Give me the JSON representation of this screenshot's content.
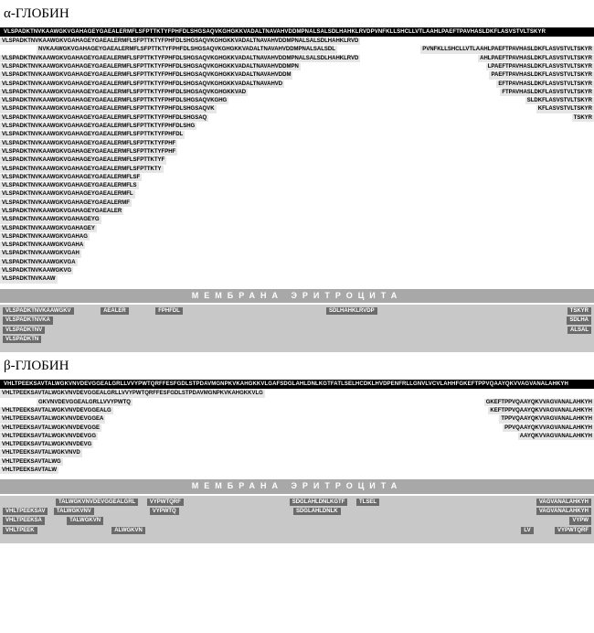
{
  "alpha": {
    "title": "α-ГЛОБИН",
    "full": "VLSPADKTNVKAAWGKVGAHAGEYGAEALERMFLSFPTTKTYFPHFDLSHGSAQVKGHGKKVADALTNAVAHVDDMPNALSALSDLHAHKLRVDPVNFKLLSHCLLVTLAAHLPAEFTPAVHASLDKFLASVSTVLTSKYR",
    "rows": [
      {
        "left": "VLSPADKTNVKAAWGKVGAHAGEYGAEALERMFLSFPTTKTYFPHFDLSHGSAQVKGHGKKVADALTNAVAHVDDMPNALSALSDLHAHKLRVD",
        "right": ""
      },
      {
        "left": "NVKAAWGKVGAHAGEYGAEALERMFLSFPTTKTYFPHFDLSHGSAQVKGHGKKVADALTNAVAHVDDMPNALSALSDL",
        "indent": true,
        "right": "PVNFKLLSHCLLVTLAAHLPAEFTPAVHASLDKFLASVSTVLTSKYR"
      },
      {
        "left": "VLSPADKTNVKAAWGKVGAHAGEYGAEALERMFLSFPTTKTYFPHFDLSHGSAQVKGHGKKVADALTNAVAHVDDMPNALSALSDLHAHKLRVD",
        "right": "AHLPAEFTPAVHASLDKFLASVSTVLTSKYR"
      },
      {
        "left": "VLSPADKTNVKAAWGKVGAHAGEYGAEALERMFLSFPTTKTYFPHFDLSHGSAQVKGHGKKVADALTNAVAHVDDMPN",
        "right": "LPAEFTPAVHASLDKFLASVSTVLTSKYR"
      },
      {
        "left": "VLSPADKTNVKAAWGKVGAHAGEYGAEALERMFLSFPTTKTYFPHFDLSHGSAQVKGHGKKVADALTNAVAHVDDM",
        "right": "PAEFTPAVHASLDKFLASVSTVLTSKYR"
      },
      {
        "left": "VLSPADKTNVKAAWGKVGAHAGEYGAEALERMFLSFPTTKTYFPHFDLSHGSAQVKGHGKKVADALTNAVAHVD",
        "right": "EFTPAVHASLDKFLASVSTVLTSKYR"
      },
      {
        "left": "VLSPADKTNVKAAWGKVGAHAGEYGAEALERMFLSFPTTKTYFPHFDLSHGSAQVKGHGKKVAD",
        "right": "FTPAVHASLDKFLASVSTVLTSKYR"
      },
      {
        "left": "VLSPADKTNVKAAWGKVGAHAGEYGAEALERMFLSFPTTKTYFPHFDLSHGSAQVKGHG",
        "right": "SLDKFLASVSTVLTSKYR"
      },
      {
        "left": "VLSPADKTNVKAAWGKVGAHAGEYGAEALERMFLSFPTTKTYFPHFDLSHGSAQVK",
        "right": "KFLASVSTVLTSKYR"
      },
      {
        "left": "VLSPADKTNVKAAWGKVGAHAGEYGAEALERMFLSFPTTKTYFPHFDLSHGSAQ",
        "right": "TSKYR"
      },
      {
        "left": "VLSPADKTNVKAAWGKVGAHAGEYGAEALERMFLSFPTTKTYFPHFDLSHG",
        "right": ""
      },
      {
        "left": "VLSPADKTNVKAAWGKVGAHAGEYGAEALERMFLSFPTTKTYFPHFDL",
        "right": ""
      },
      {
        "left": "VLSPADKTNVKAAWGKVGAHAGEYGAEALERMFLSFPTTKTYFPHF",
        "right": ""
      },
      {
        "left": "VLSPADKTNVKAAWGKVGAHAGEYGAEALERMFLSFPTTKTYFPHF",
        "right": ""
      },
      {
        "left": "VLSPADKTNVKAAWGKVGAHAGEYGAEALERMFLSFPTTKTYF",
        "right": ""
      },
      {
        "left": "VLSPADKTNVKAAWGKVGAHAGEYGAEALERMFLSFPTTKTY",
        "right": ""
      },
      {
        "left": "VLSPADKTNVKAAWGKVGAHAGEYGAEALERMFLSF",
        "right": ""
      },
      {
        "left": "VLSPADKTNVKAAWGKVGAHAGEYGAEALERMFLS",
        "right": ""
      },
      {
        "left": "VLSPADKTNVKAAWGKVGAHAGEYGAEALERMFL",
        "right": ""
      },
      {
        "left": "VLSPADKTNVKAAWGKVGAHAGEYGAEALERMF",
        "right": ""
      },
      {
        "left": "VLSPADKTNVKAAWGKVGAHAGEYGAEALER",
        "right": ""
      },
      {
        "left": "VLSPADKTNVKAAWGKVGAHAGEYG",
        "right": ""
      },
      {
        "left": "VLSPADKTNVKAAWGKVGAHAGEY",
        "right": ""
      },
      {
        "left": "VLSPADKTNVKAAWGKVGAHAG",
        "right": ""
      },
      {
        "left": "VLSPADKTNVKAAWGKVGAHA",
        "right": ""
      },
      {
        "left": "VLSPADKTNVKAAWGKVGAH",
        "right": ""
      },
      {
        "left": "VLSPADKTNVKAAWGKVGA",
        "right": ""
      },
      {
        "left": "VLSPADKTNVKAAWGKVG",
        "right": ""
      },
      {
        "left": "VLSPADKTNVKAAW",
        "right": ""
      }
    ],
    "membrane_label": "МЕМБРАНА  ЭРИТРОЦИТА",
    "mem_rows": [
      [
        {
          "t": "VLSPADKTNVKAAWGKV"
        },
        {
          "sp": 1
        },
        {
          "t": "AEALER"
        },
        {
          "sp": 1
        },
        {
          "t": "FPHFDL"
        },
        {
          "sp": 6
        },
        {
          "t": "SDLHAHKLRVDP"
        },
        {
          "sp": 8
        },
        {
          "t": "TSKYR"
        }
      ],
      [
        {
          "t": "VLSPADKTNVKA"
        },
        {
          "sp": 18
        },
        {
          "t": "SDLHA"
        }
      ],
      [
        {
          "t": "VLSPADKTNV"
        },
        {
          "sp": 18
        },
        {
          "t": "ALSAL"
        }
      ],
      [
        {
          "t": "VLSPADKTN"
        }
      ]
    ]
  },
  "beta": {
    "title": "β-ГЛОБИН",
    "full": "VHLTPEEKSAVTALWGKVNVDEVGGEALGRLLVVYPWTQRFFESFGDLSTPDAVMGNPKVKAHGKKVLGAFSDGLAHLDNLKGTFATLSELHCDKLHVDPENFRLLGNVLVCVLAHHFGKEFTPPVQAAYQKVVAGVANALAHKYH",
    "rows": [
      {
        "left": "VHLTPEEKSAVTALWGKVNVDEVGGEALGRLLVVYPWTQRFFESFGDLSTPDAVMGNPKVKAHGKKVLG",
        "right": ""
      },
      {
        "left": "GKVNVDEVGGEALGRLLVVYPWTQ",
        "indent": true,
        "right": "GKEFTPPVQAAYQKVVAGVANALAHKYH"
      },
      {
        "left": "VHLTPEEKSAVTALWGKVNVDEVGGEALG",
        "right": "KEFTPPVQAAYQKVVAGVANALAHKYH"
      },
      {
        "left": "VHLTPEEKSAVTALWGKVNVDEVGGEA",
        "right": "TPPVQAAYQKVVAGVANALAHKYH"
      },
      {
        "left": "VHLTPEEKSAVTALWGKVNVDEVGGE",
        "right": "PPVQAAYQKVVAGVANALAHKYH"
      },
      {
        "left": "VHLTPEEKSAVTALWGKVNVDEVGG",
        "right": "AAYQKVVAGVANALAHKYH"
      },
      {
        "left": "VHLTPEEKSAVTALWGKVNVDEVG",
        "right": ""
      },
      {
        "left": "VHLTPEEKSAVTALWGKVNVD",
        "right": ""
      },
      {
        "left": "VHLTPEEKSAVTALWG",
        "right": ""
      },
      {
        "left": "VHLTPEEKSAVTALW",
        "right": ""
      }
    ],
    "membrane_label": "МЕМБРАНА  ЭРИТРОЦИТА",
    "mem_rows": [
      [
        {
          "sp": 2
        },
        {
          "t": "TALWGKVNVDEVGGEALGRL"
        },
        {
          "sp": 0.2
        },
        {
          "t": "VYPWTQRF"
        },
        {
          "sp": 4
        },
        {
          "t": "SDGLAHLDNLKGTF"
        },
        {
          "sp": 0.2
        },
        {
          "t": "TLSEL"
        },
        {
          "sp": 6
        },
        {
          "t": "VAGVANALAHKYH"
        }
      ],
      [
        {
          "t": "VHLTPEEKSAV"
        },
        {
          "sp": 0.1
        },
        {
          "t": "TALWGKVNV"
        },
        {
          "sp": 2.3
        },
        {
          "t": "VYPWTQ"
        },
        {
          "sp": 4.9
        },
        {
          "t": "SDGLAHLDNLK"
        },
        {
          "sp": 8.5
        },
        {
          "t": "VAGVANALAHKYH"
        }
      ],
      [
        {
          "t": "VHLTPEEKSA"
        },
        {
          "sp": 0.1
        },
        {
          "t": "TALWGKVN"
        },
        {
          "sp": 2.5
        },
        {
          "t": "VYPW"
        }
      ],
      [
        {
          "t": "VHLTPEEK"
        },
        {
          "sp": 0.4
        },
        {
          "t": "ALWGKVN"
        },
        {
          "sp": 2.1
        },
        {
          "t": "LV"
        },
        {
          "sp": 0.1
        },
        {
          "t": "VYPWTQRF"
        }
      ]
    ]
  }
}
